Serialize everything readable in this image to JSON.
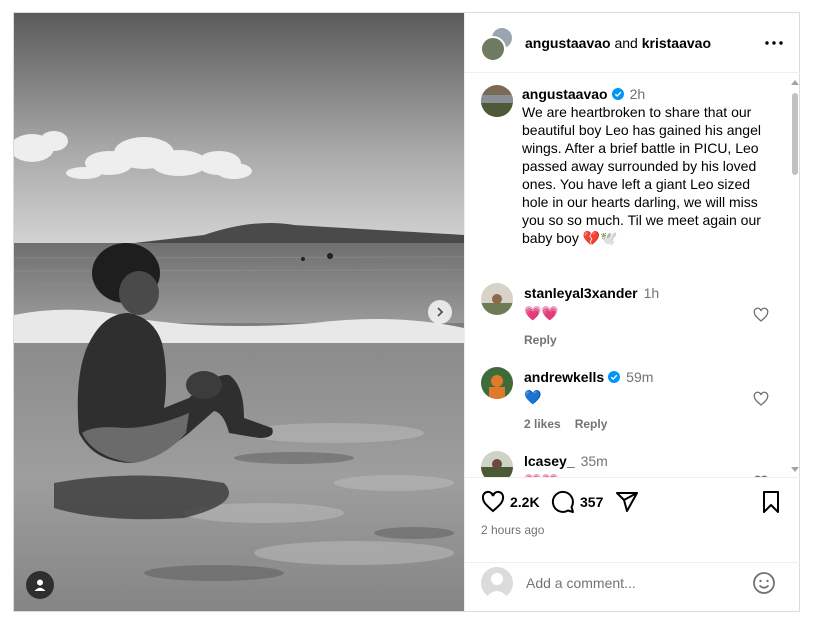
{
  "header": {
    "user1": "angustaavao",
    "connector": "and",
    "user2": "kristaavao"
  },
  "caption": {
    "username": "angustaavao",
    "time": "2h",
    "text": "We are heartbroken to share that our beautiful boy Leo has gained his angel wings. After a brief battle in PICU, Leo passed away surrounded by his loved ones. You have left a giant Leo sized hole in our hearts darling, we will miss you so so much. Til we meet again our baby boy 💔🕊️"
  },
  "comments": [
    {
      "username": "stanleyal3xander",
      "time": "1h",
      "text": "💗💗",
      "likes": "",
      "reply": "Reply",
      "verified": false
    },
    {
      "username": "andrewkells",
      "time": "59m",
      "text": "💙",
      "likes": "2 likes",
      "reply": "Reply",
      "verified": true
    },
    {
      "username": "lcasey_",
      "time": "35m",
      "text": "💗💗",
      "likes": "",
      "reply": "",
      "verified": false
    }
  ],
  "stats": {
    "likes": "2.2K",
    "comments": "357",
    "posted": "2 hours ago"
  },
  "add_comment": {
    "placeholder": "Add a comment..."
  },
  "colors": {
    "verified": "#0095f6",
    "muted": "#737373"
  },
  "icons": {
    "like": "heart-icon",
    "comment": "comment-icon",
    "share": "paper-plane-icon",
    "save": "bookmark-icon",
    "more": "more-horizontal-icon",
    "next": "chevron-right-icon",
    "tagged": "person-icon",
    "emoji": "smiley-icon"
  }
}
